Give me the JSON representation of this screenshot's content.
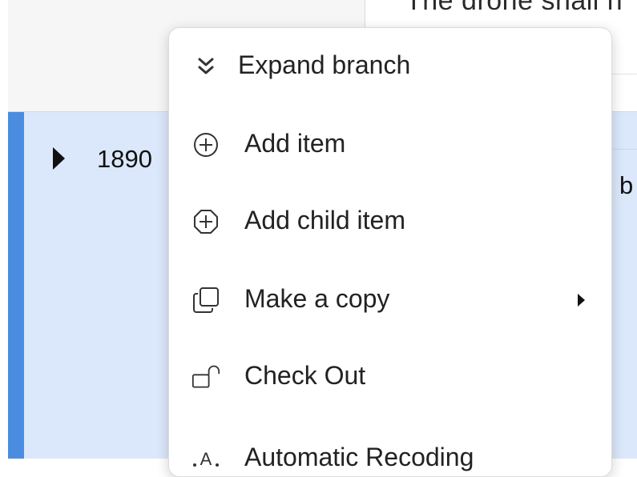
{
  "background": {
    "truncated_header_text": "The drone shall n",
    "selected_row": {
      "id": "1890",
      "text_fragment": "b"
    }
  },
  "context_menu": {
    "items": [
      {
        "label": "Expand branch",
        "icon": "double-chevron-down-icon"
      },
      {
        "label": "Add item",
        "icon": "plus-circle-icon"
      },
      {
        "label": "Add child item",
        "icon": "plus-octagon-icon"
      },
      {
        "label": "Make a copy",
        "icon": "copy-icon",
        "has_submenu": true
      },
      {
        "label": "Check Out",
        "icon": "unlock-icon"
      },
      {
        "label": "Automatic Recoding",
        "icon": "automatic-recoding-icon"
      }
    ]
  },
  "colors": {
    "selected_row_bg": "#dbe8fb",
    "row_accent": "#4a8de0",
    "menu_bg": "#ffffff"
  }
}
